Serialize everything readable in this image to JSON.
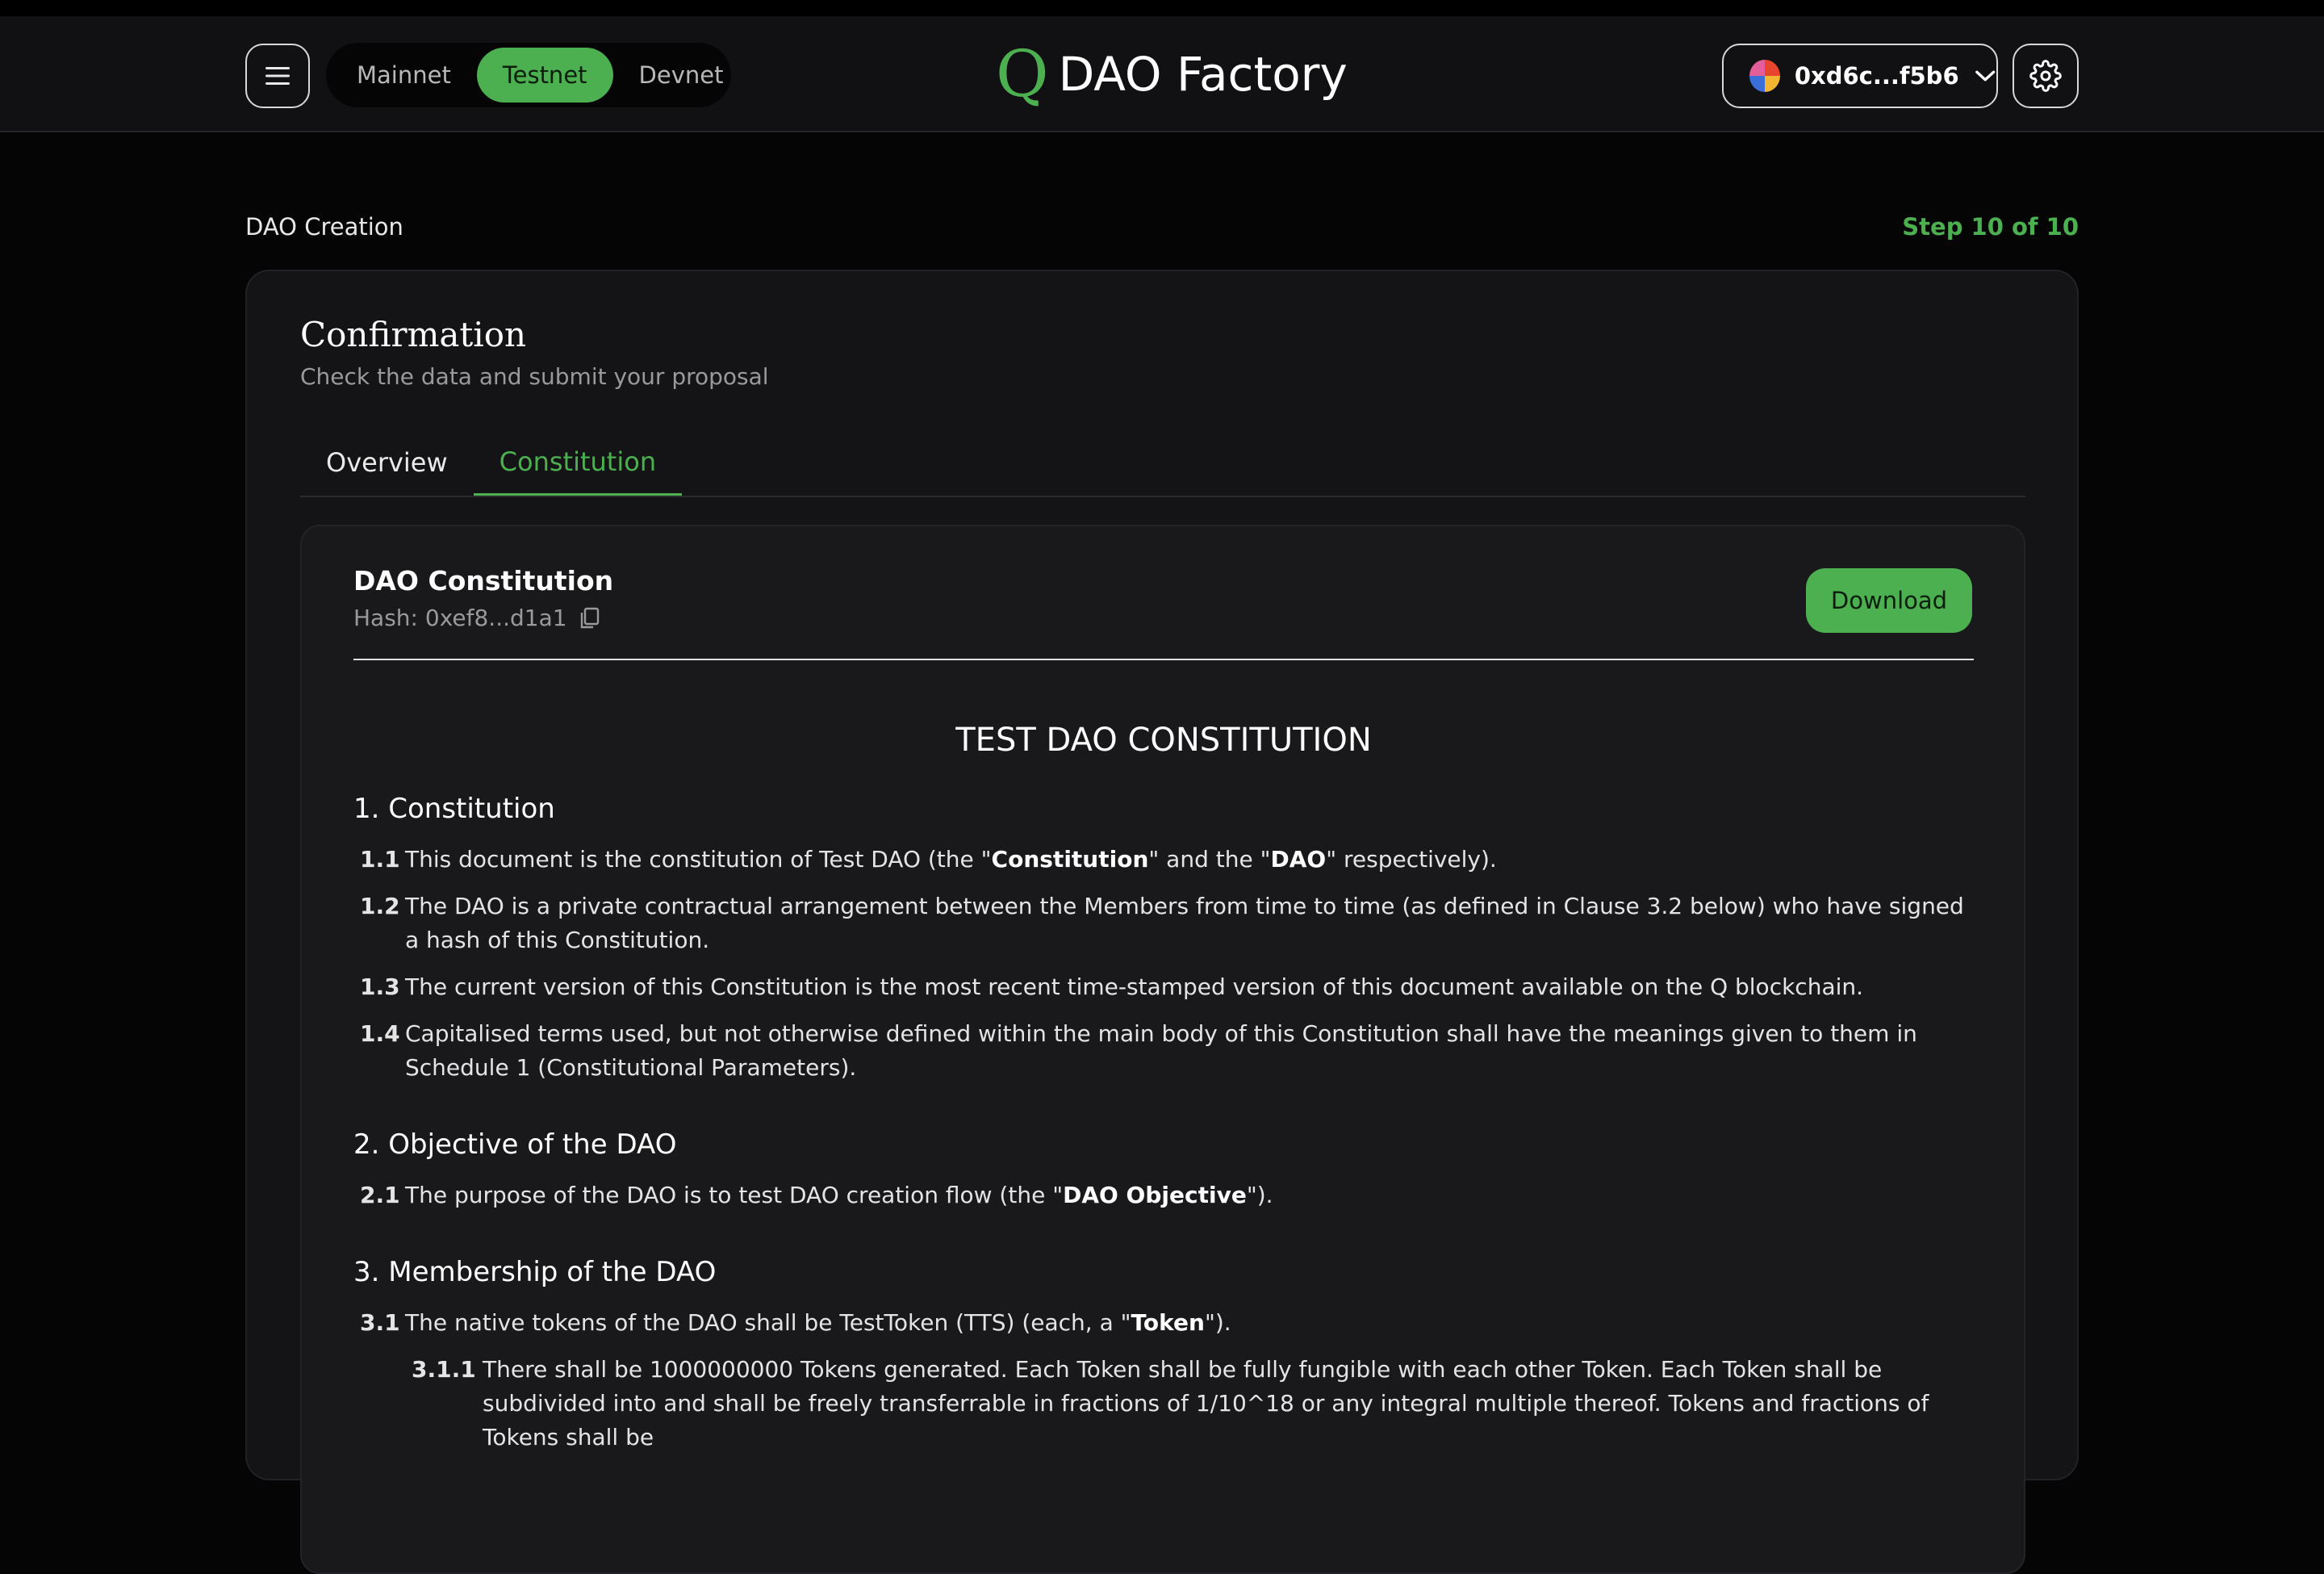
{
  "header": {
    "networks": [
      "Mainnet",
      "Testnet",
      "Devnet"
    ],
    "active_network": "Testnet",
    "logo_letter": "Q",
    "app_title": "DAO Factory",
    "wallet_address": "0xd6c...f5b6"
  },
  "breadcrumb": "DAO Creation",
  "step_label": "Step 10 of 10",
  "card": {
    "title": "Confirmation",
    "subtitle": "Check the data and submit your proposal",
    "tabs": [
      "Overview",
      "Constitution"
    ],
    "active_tab": "Constitution"
  },
  "document": {
    "title": "DAO Constitution",
    "hash": "Hash: 0xef8...d1a1",
    "download_label": "Download",
    "main_title": "TEST DAO CONSTITUTION",
    "sections": {
      "s1": "1. Constitution",
      "s2": "2. Objective of the DAO",
      "s3": "3. Membership of the DAO"
    },
    "clauses": {
      "c1_1": {
        "num": "1.1",
        "pre": "This document is the constitution of Test DAO (the \"",
        "b1": "Constitution",
        "mid": "\" and the \"",
        "b2": "DAO",
        "post": "\" respectively)."
      },
      "c1_2": {
        "num": "1.2",
        "text": "The DAO is a private contractual arrangement between the Members from time to time (as defined in Clause 3.2 below) who have signed a hash of this Constitution."
      },
      "c1_3": {
        "num": "1.3",
        "text": "The current version of this Constitution is the most recent time-stamped version of this document available on the Q blockchain."
      },
      "c1_4": {
        "num": "1.4",
        "text": "Capitalised terms used, but not otherwise defined within the main body of this Constitution shall have the meanings given to them in Schedule 1 (Constitutional Parameters)."
      },
      "c2_1": {
        "num": "2.1",
        "pre": "The purpose of the DAO is to test DAO creation flow (the \"",
        "b1": "DAO Objective",
        "post": "\")."
      },
      "c3_1": {
        "num": "3.1",
        "pre": "The native tokens of the DAO shall be TestToken (TTS) (each, a \"",
        "b1": "Token",
        "post": "\")."
      },
      "c3_1_1": {
        "num": "3.1.1",
        "text": "There shall be 1000000000 Tokens generated. Each Token shall be fully fungible with each other Token. Each Token shall be subdivided into and shall be freely transferrable in fractions of 1/10^18 or any integral multiple thereof. Tokens and fractions of Tokens shall be"
      }
    }
  },
  "icons": {
    "menu": "hamburger-menu-icon",
    "chevron": "chevron-down-icon",
    "settings": "gear-icon",
    "copy": "copy-icon"
  },
  "colors": {
    "accent": "#4caf50",
    "background": "#050505",
    "surface": "#141416"
  }
}
